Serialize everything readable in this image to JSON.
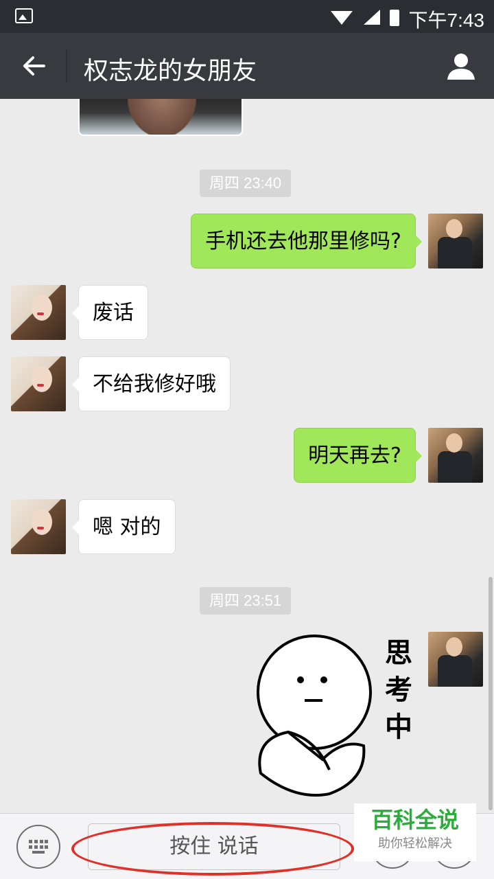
{
  "status_bar": {
    "time": "下午7:43"
  },
  "title_bar": {
    "title": "权志龙的女朋友"
  },
  "messages": [
    {
      "type": "time",
      "text": "周四 23:40"
    },
    {
      "type": "bubble",
      "side": "right",
      "text": "手机还去他那里修吗?"
    },
    {
      "type": "bubble",
      "side": "left",
      "text": "废话"
    },
    {
      "type": "bubble",
      "side": "left",
      "text": "不给我修好哦"
    },
    {
      "type": "bubble",
      "side": "right",
      "text": "明天再去?"
    },
    {
      "type": "bubble",
      "side": "left",
      "text": "嗯 对的"
    },
    {
      "type": "time",
      "text": "周四 23:51"
    },
    {
      "type": "sticker",
      "side": "right",
      "text": "思考中"
    }
  ],
  "input_bar": {
    "hold_to_talk": "按住 说话"
  },
  "watermark": {
    "title": "百科全说",
    "subtitle": "助你轻松解决"
  },
  "colors": {
    "accent_bubble": "#a0e75a",
    "titlebar": "#393a3f",
    "annotation": "#e0302a"
  }
}
